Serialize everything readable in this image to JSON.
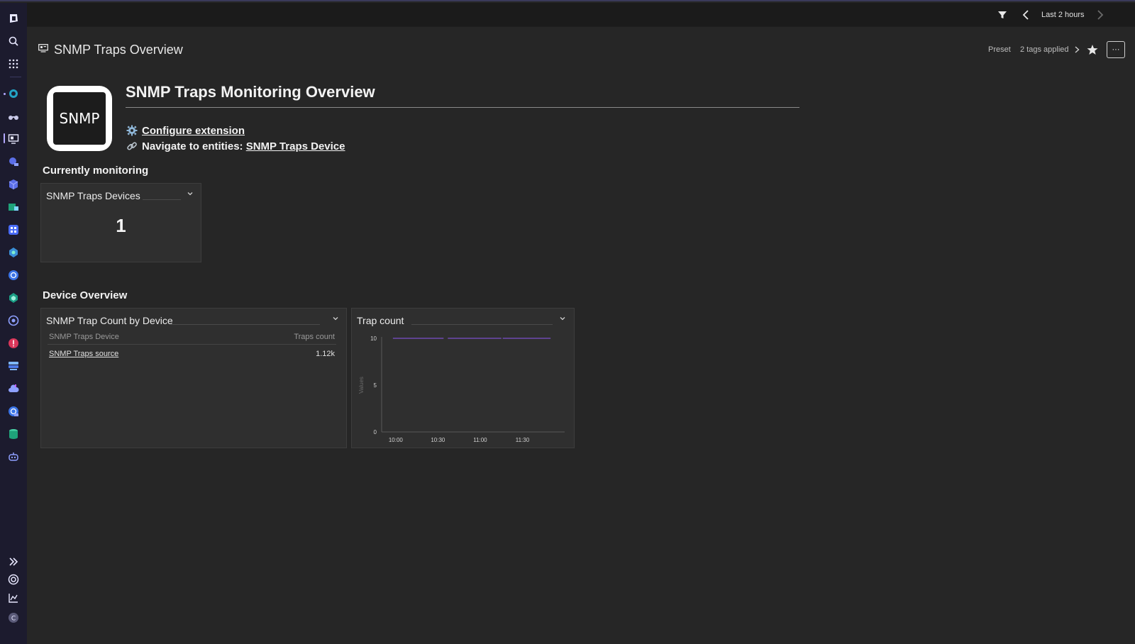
{
  "topbar": {
    "timeframe_label": "Last 2 hours"
  },
  "header": {
    "title": "SNMP Traps Overview",
    "preset_label": "Preset",
    "tags_label": "2 tags applied",
    "more_label": "···"
  },
  "markdown": {
    "logo_text": "SNMP",
    "heading": "SNMP Traps Monitoring Overview",
    "configure_link": "Configure extension",
    "navigate_prefix": "Navigate to entities: ",
    "navigate_link": "SNMP Traps Device"
  },
  "sections": {
    "currently_monitoring": "Currently monitoring",
    "device_overview": "Device Overview"
  },
  "tiles": {
    "devices": {
      "title": "SNMP Traps Devices",
      "value": "1"
    },
    "trap_count_by_device": {
      "title": "SNMP Trap Count by Device",
      "columns": [
        "SNMP Traps Device",
        "Traps count"
      ],
      "rows": [
        {
          "device": "SNMP Traps source",
          "count": "1.12k"
        }
      ]
    },
    "trap_count": {
      "title": "Trap count"
    }
  },
  "colors": {
    "accent": "#b3a9ff",
    "series": "#7b4fc9",
    "background": "#262626",
    "tile": "#2f2f2f"
  },
  "chart_data": {
    "type": "line",
    "title": "Trap count",
    "ylabel": "Values",
    "xlabel": "",
    "x_ticks": [
      "10:00",
      "10:30",
      "11:00",
      "11:30"
    ],
    "y_ticks": [
      0,
      5,
      10
    ],
    "ylim": [
      0,
      10
    ],
    "series": [
      {
        "x": [
          "09:58",
          "10:34",
          "10:37",
          "11:15",
          "11:16",
          "11:50"
        ],
        "values": [
          10,
          10,
          10,
          10,
          10,
          10
        ],
        "segments": [
          [
            "09:58",
            "10:34"
          ],
          [
            "10:37",
            "11:15"
          ],
          [
            "11:16",
            "11:50"
          ]
        ]
      }
    ]
  }
}
